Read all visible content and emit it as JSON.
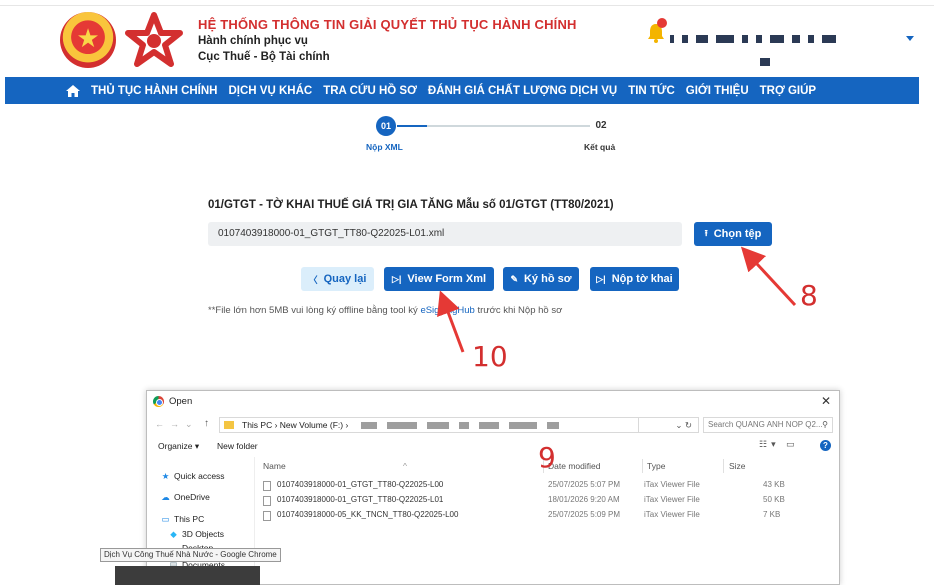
{
  "header": {
    "title": "HỆ THỐNG THÔNG TIN GIẢI QUYẾT THỦ TỤC HÀNH CHÍNH",
    "subtitle1": "Hành chính phục vụ",
    "subtitle2": "Cục Thuế - Bộ Tài chính",
    "colors": {
      "brand_red": "#d32f2f",
      "nav_blue": "#1565c0"
    }
  },
  "nav": {
    "items": [
      {
        "label": "THỦ TỤC HÀNH CHÍNH"
      },
      {
        "label": "DỊCH VỤ KHÁC"
      },
      {
        "label": "TRA CỨU HỒ SƠ"
      },
      {
        "label": "ĐÁNH GIÁ CHẤT LƯỢNG DỊCH VỤ"
      },
      {
        "label": "TIN TỨC"
      },
      {
        "label": "GIỚI THIỆU"
      },
      {
        "label": "TRỢ GIÚP"
      }
    ]
  },
  "stepper": {
    "step1": {
      "number": "01",
      "label": "Nộp XML"
    },
    "step2": {
      "number": "02",
      "label": "Kết quả"
    }
  },
  "form": {
    "title": "01/GTGT - TỜ KHAI THUẾ GIÁ TRỊ GIA TĂNG Mẫu số 01/GTGT (TT80/2021)",
    "file_name": "0107403918000-01_GTGT_TT80-Q22025-L01.xml",
    "choose_file_label": "Chọn tệp",
    "back_label": "Quay lại",
    "view_form_label": "View Form Xml",
    "sign_label": "Ký hồ sơ",
    "submit_label": "Nộp tờ khai",
    "note_prefix": "**File lớn hơn 5MB vui lòng ký offline bằng tool ký ",
    "note_link": "eSigningHub",
    "note_suffix": " trước khi Nộp hồ sơ"
  },
  "annotations": {
    "n8": "8",
    "n9": "9",
    "n10": "10"
  },
  "dialog": {
    "title": "Open",
    "path_this_pc": "This PC",
    "path_volume": "New Volume (F:)",
    "search_placeholder": "Search QUANG ANH NOP Q2...",
    "organize_label": "Organize ▾",
    "new_folder_label": "New folder",
    "sidebar": [
      {
        "label": "Quick access",
        "icon": "star-icon"
      },
      {
        "label": "OneDrive",
        "icon": "cloud-icon"
      },
      {
        "label": "This PC",
        "icon": "computer-icon"
      },
      {
        "label": "3D Objects",
        "icon": "cube-icon"
      },
      {
        "label": "Desktop",
        "icon": "desktop-icon"
      },
      {
        "label": "Documents",
        "icon": "documents-icon"
      }
    ],
    "columns": {
      "name": "Name",
      "date": "Date modified",
      "type": "Type",
      "size": "Size"
    },
    "files": [
      {
        "name": "0107403918000-01_GTGT_TT80-Q22025-L00",
        "date": "25/07/2025 5:07 PM",
        "type": "iTax Viewer File",
        "size": "43 KB"
      },
      {
        "name": "0107403918000-01_GTGT_TT80-Q22025-L01",
        "date": "18/01/2026 9:20 AM",
        "type": "iTax Viewer File",
        "size": "50 KB"
      },
      {
        "name": "0107403918000-05_KK_TNCN_TT80-Q22025-L00",
        "date": "25/07/2025 5:09 PM",
        "type": "iTax Viewer File",
        "size": "7 KB"
      }
    ]
  },
  "tooltip": "Dịch Vụ Công Thuế Nhà Nước - Google Chrome"
}
